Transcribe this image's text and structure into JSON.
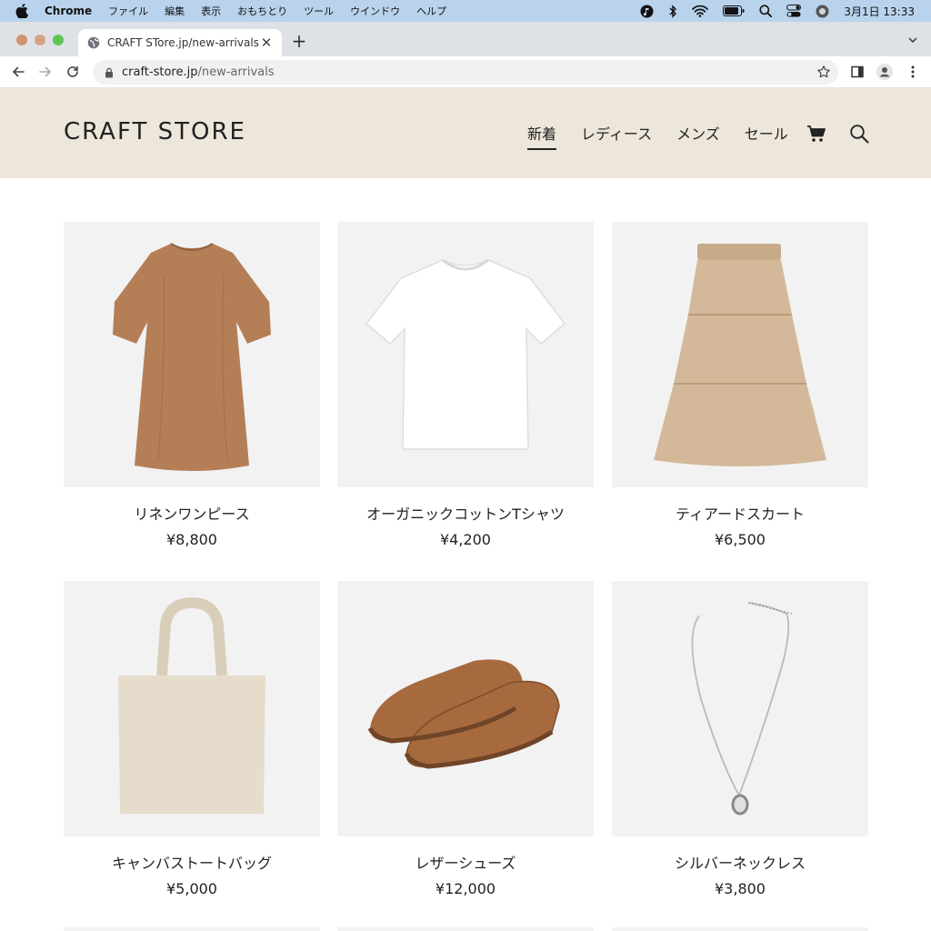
{
  "menubar": {
    "app_name": "Chrome",
    "items": [
      "ファイル",
      "編集",
      "表示",
      "おもちとり",
      "ツール",
      "ウインドウ",
      "ヘルプ"
    ],
    "clock": "3月1日 13:33"
  },
  "browser": {
    "tab_title": "CRAFT STore.jp/new-arrivals",
    "url_host": "craft-store.jp",
    "url_path": "/new-arrivals"
  },
  "store": {
    "logo": "CRAFT STORE",
    "nav": [
      "新着",
      "レディース",
      "メンズ",
      "セール"
    ]
  },
  "products": [
    {
      "name": "リネンワンピース",
      "price": "¥8,800",
      "color": "#b47e57"
    },
    {
      "name": "オーガニックコットンTシャツ",
      "price": "¥4,200",
      "color": "#ffffff"
    },
    {
      "name": "ティアードスカート",
      "price": "¥6,500",
      "color": "#d3b999"
    },
    {
      "name": "キャンバストートバッグ",
      "price": "¥5,000",
      "color": "#e6dccb"
    },
    {
      "name": "レザーシューズ",
      "price": "¥12,000",
      "color": "#a76a3f"
    },
    {
      "name": "シルバーネックレス",
      "price": "¥3,800",
      "color": "#b9b9b9"
    }
  ],
  "colors": {
    "menubar_bg": "#b9d3ec",
    "header_bg": "#ede6da",
    "card_bg": "#f2f2f2"
  }
}
